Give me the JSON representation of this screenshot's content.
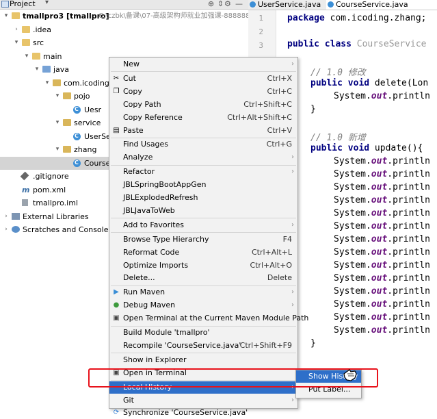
{
  "project_panel": {
    "title": "Project",
    "dropdown_glyph": "▾",
    "header_icons": [
      "target-icon",
      "collapse-icon",
      "gear-icon",
      "minimize-icon"
    ],
    "tree": [
      {
        "label": "tmallpro3 [tmallpro]",
        "hint": "C:\\czbk\\备课\\07-高级架构师就业加强课-888888",
        "level": 0,
        "arrow": "▾",
        "icon": "folder"
      },
      {
        "label": ".idea",
        "level": 1,
        "arrow": "›",
        "icon": "folder"
      },
      {
        "label": "src",
        "level": 1,
        "arrow": "▾",
        "icon": "folder"
      },
      {
        "label": "main",
        "level": 2,
        "arrow": "▾",
        "icon": "folder"
      },
      {
        "label": "java",
        "level": 3,
        "arrow": "▾",
        "icon": "folder-blue"
      },
      {
        "label": "com.icoding",
        "level": 4,
        "arrow": "▾",
        "icon": "pkg"
      },
      {
        "label": "pojo",
        "level": 5,
        "arrow": "▾",
        "icon": "pkg"
      },
      {
        "label": "Uesr",
        "level": 6,
        "arrow": "",
        "icon": "cls"
      },
      {
        "label": "service",
        "level": 5,
        "arrow": "▾",
        "icon": "pkg"
      },
      {
        "label": "UserSe",
        "level": 6,
        "arrow": "",
        "icon": "cls"
      },
      {
        "label": "zhang",
        "level": 5,
        "arrow": "▾",
        "icon": "pkg"
      },
      {
        "label": "Course",
        "level": 6,
        "arrow": "",
        "icon": "cls",
        "selected": true
      },
      {
        "label": ".gitignore",
        "level": 1,
        "arrow": "",
        "icon": "gitignore"
      },
      {
        "label": "pom.xml",
        "level": 1,
        "arrow": "",
        "icon": "maven"
      },
      {
        "label": "tmallpro.iml",
        "level": 1,
        "arrow": "",
        "icon": "iml"
      },
      {
        "label": "External Libraries",
        "level": 0,
        "arrow": "›",
        "icon": "libraries"
      },
      {
        "label": "Scratches and Consoles",
        "level": 0,
        "arrow": "›",
        "icon": "scratches"
      }
    ]
  },
  "editor": {
    "tabs": [
      {
        "label": "UserService.java",
        "active": false
      },
      {
        "label": "CourseService.java",
        "active": true
      }
    ],
    "line_numbers": [
      "1",
      "2",
      "3"
    ],
    "code": {
      "l1_kw": "package",
      "l1_rest": " com.icoding.zhang;",
      "l3_kw": "public class",
      "l3_rest": " CourseService",
      "c1": "// 1.0 修改",
      "m1_kw": "public void",
      "m1_rest": " delete(Lon",
      "sys": "System.",
      "out": "out",
      "println": ".println",
      "brace_close": "}",
      "c2": "// 1.0 新增",
      "m2_kw": "public void",
      "m2_rest": " update(){"
    }
  },
  "context_menu": {
    "items": [
      {
        "label": "New",
        "shortcut": "",
        "submenu": true,
        "icon": ""
      },
      {
        "sep": true
      },
      {
        "label": "Cut",
        "shortcut": "Ctrl+X",
        "icon": "scissors-icon"
      },
      {
        "label": "Copy",
        "shortcut": "Ctrl+C",
        "icon": "copy-icon"
      },
      {
        "label": "Copy Path",
        "shortcut": "Ctrl+Shift+C"
      },
      {
        "label": "Copy Reference",
        "shortcut": "Ctrl+Alt+Shift+C"
      },
      {
        "label": "Paste",
        "shortcut": "Ctrl+V",
        "icon": "paste-icon"
      },
      {
        "sep": true
      },
      {
        "label": "Find Usages",
        "shortcut": "Ctrl+G"
      },
      {
        "label": "Analyze",
        "submenu": true
      },
      {
        "sep": true
      },
      {
        "label": "Refactor",
        "submenu": true
      },
      {
        "label": "JBLSpringBootAppGen"
      },
      {
        "label": "JBLExplodedRefresh"
      },
      {
        "label": "JBLJavaToWeb"
      },
      {
        "sep": true
      },
      {
        "label": "Add to Favorites",
        "submenu": true
      },
      {
        "sep": true
      },
      {
        "label": "Browse Type Hierarchy",
        "shortcut": "F4"
      },
      {
        "label": "Reformat Code",
        "shortcut": "Ctrl+Alt+L"
      },
      {
        "label": "Optimize Imports",
        "shortcut": "Ctrl+Alt+O"
      },
      {
        "label": "Delete...",
        "shortcut": "Delete"
      },
      {
        "sep": true
      },
      {
        "label": "Run Maven",
        "submenu": true,
        "icon": "run-maven-icon"
      },
      {
        "label": "Debug Maven",
        "submenu": true,
        "icon": "debug-maven-icon"
      },
      {
        "label": "Open Terminal at the Current Maven Module Path",
        "icon": "terminal-icon"
      },
      {
        "sep": true
      },
      {
        "label": "Build Module 'tmallpro'"
      },
      {
        "label": "Recompile 'CourseService.java'",
        "shortcut": "Ctrl+Shift+F9"
      },
      {
        "sep": true
      },
      {
        "label": "Show in Explorer"
      },
      {
        "label": "Open in Terminal",
        "icon": "terminal-icon"
      },
      {
        "sep": true
      },
      {
        "label": "Local History",
        "submenu": true,
        "highlighted": true
      },
      {
        "label": "Git",
        "submenu": true
      },
      {
        "label": "Synchronize 'CourseService.java'",
        "icon": "sync-icon"
      }
    ]
  },
  "local_history_submenu": {
    "items": [
      {
        "label": "Show History",
        "highlighted": true
      },
      {
        "label": "Put Label..."
      }
    ]
  },
  "colors": {
    "highlight": "#2e6fc9",
    "annotation_outline": "#e8121b"
  }
}
